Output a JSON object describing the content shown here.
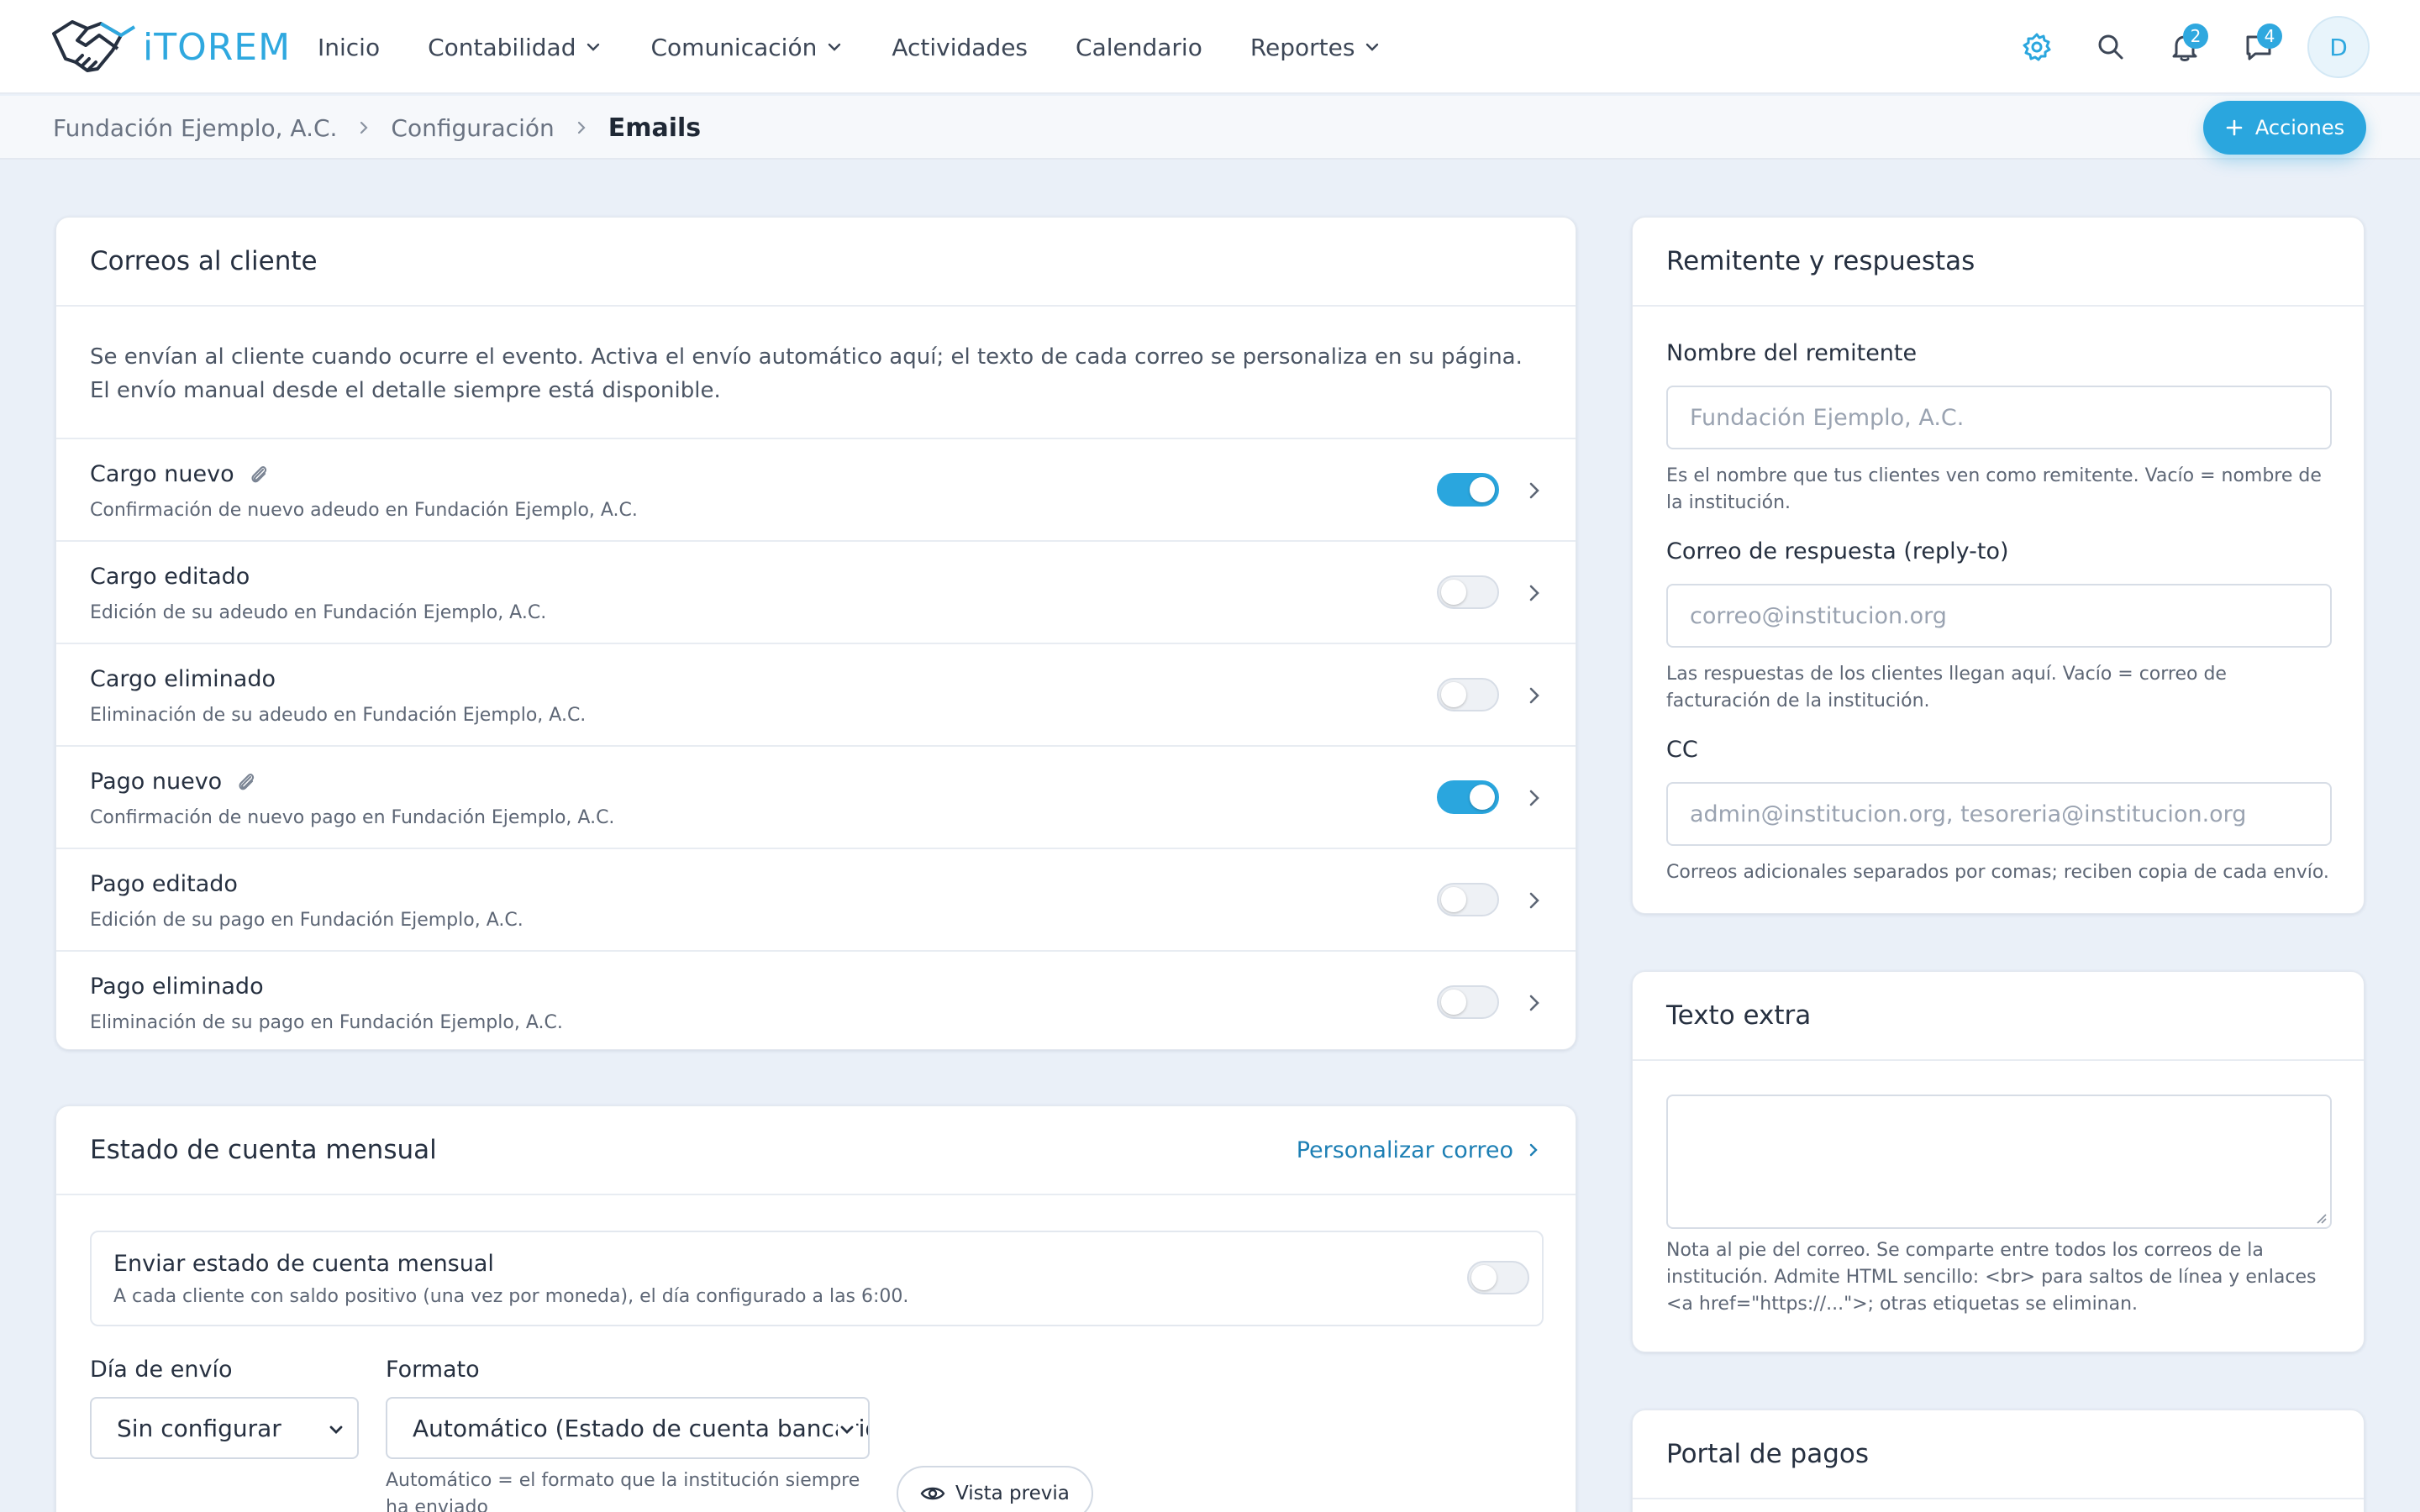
{
  "app": {
    "logo_text": "iTOREM",
    "user_initial": "D"
  },
  "nav": [
    {
      "label": "Inicio",
      "dropdown": false
    },
    {
      "label": "Contabilidad",
      "dropdown": true
    },
    {
      "label": "Comunicación",
      "dropdown": true
    },
    {
      "label": "Actividades",
      "dropdown": false
    },
    {
      "label": "Calendario",
      "dropdown": false
    },
    {
      "label": "Reportes",
      "dropdown": true
    }
  ],
  "top_icons": {
    "notifications_count": "2",
    "messages_count": "4"
  },
  "breadcrumb": {
    "org": "Fundación Ejemplo, A.C.",
    "section": "Configuración",
    "current": "Emails"
  },
  "actions_label": "Acciones",
  "client_emails": {
    "title": "Correos al cliente",
    "description": "Se envían al cliente cuando ocurre el evento. Activa el envío automático aquí; el texto de cada correo se personaliza en su página. El envío manual desde el detalle siempre está disponible.",
    "rows": [
      {
        "title": "Cargo nuevo",
        "subtitle": "Confirmación de nuevo adeudo en Fundación Ejemplo, A.C.",
        "attachment": true,
        "enabled": true
      },
      {
        "title": "Cargo editado",
        "subtitle": "Edición de su adeudo en Fundación Ejemplo, A.C.",
        "attachment": false,
        "enabled": false
      },
      {
        "title": "Cargo eliminado",
        "subtitle": "Eliminación de su adeudo en Fundación Ejemplo, A.C.",
        "attachment": false,
        "enabled": false
      },
      {
        "title": "Pago nuevo",
        "subtitle": "Confirmación de nuevo pago en Fundación Ejemplo, A.C.",
        "attachment": true,
        "enabled": true
      },
      {
        "title": "Pago editado",
        "subtitle": "Edición de su pago en Fundación Ejemplo, A.C.",
        "attachment": false,
        "enabled": false
      },
      {
        "title": "Pago eliminado",
        "subtitle": "Eliminación de su pago en Fundación Ejemplo, A.C.",
        "attachment": false,
        "enabled": false
      }
    ]
  },
  "monthly": {
    "title": "Estado de cuenta mensual",
    "customize_link": "Personalizar correo",
    "send_title": "Enviar estado de cuenta mensual",
    "send_subtitle": "A cada cliente con saldo positivo (una vez por moneda), el día configurado a las 6:00.",
    "send_enabled": false,
    "day_label": "Día de envío",
    "day_value": "Sin configurar",
    "format_label": "Formato",
    "format_value": "Automático (Estado de cuenta bancario)",
    "format_help": "Automático = el formato que la institución siempre ha enviado",
    "preview_label": "Vista previa"
  },
  "sender": {
    "title": "Remitente y respuestas",
    "name_label": "Nombre del remitente",
    "name_placeholder": "Fundación Ejemplo, A.C.",
    "name_help": "Es el nombre que tus clientes ven como remitente. Vacío = nombre de la institución.",
    "reply_label": "Correo de respuesta (reply-to)",
    "reply_placeholder": "correo@institucion.org",
    "reply_help": "Las respuestas de los clientes llegan aquí. Vacío = correo de facturación de la institución.",
    "cc_label": "CC",
    "cc_placeholder": "admin@institucion.org, tesoreria@institucion.org",
    "cc_help": "Correos adicionales separados por comas; reciben copia de cada envío."
  },
  "extra_text": {
    "title": "Texto extra",
    "help": "Nota al pie del correo. Se comparte entre todos los correos de la institución. Admite HTML sencillo: <br> para saltos de línea y enlaces <a href=\"https://...\">; otras etiquetas se eliminan."
  },
  "payments_portal": {
    "title": "Portal de pagos"
  },
  "colors": {
    "accent": "#2aa6de",
    "link": "#1d7fb4",
    "background": "#eaf0f8"
  }
}
